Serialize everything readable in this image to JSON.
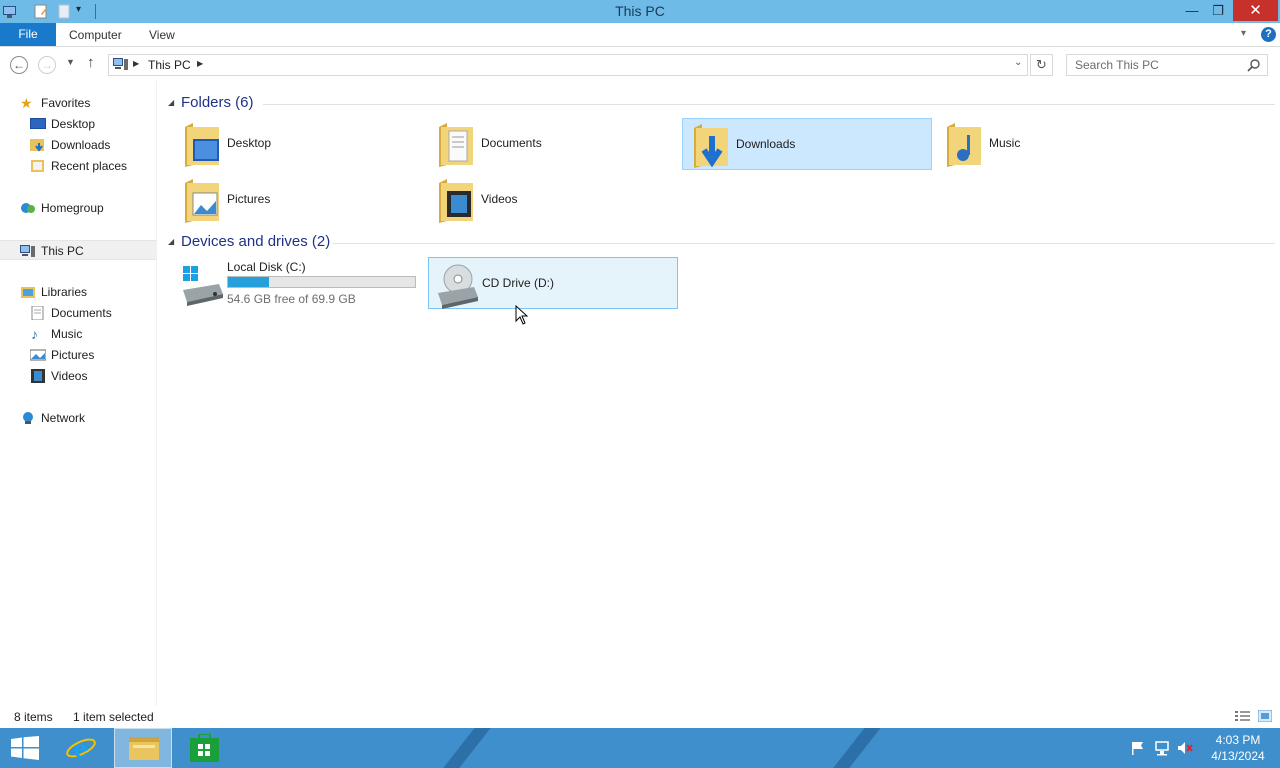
{
  "window": {
    "title": "This PC"
  },
  "quick_access": {
    "dropdown": "▾"
  },
  "window_controls": {
    "minimize": "—",
    "restore": "❐",
    "close": "✕"
  },
  "ribbon": {
    "file": "File",
    "tabs": [
      "Computer",
      "View"
    ],
    "help": "?"
  },
  "address": {
    "location": "This PC",
    "search_placeholder": "Search This PC"
  },
  "nav_pane": {
    "favorites": "Favorites",
    "favorites_items": [
      "Desktop",
      "Downloads",
      "Recent places"
    ],
    "homegroup": "Homegroup",
    "this_pc": "This PC",
    "libraries": "Libraries",
    "libraries_items": [
      "Documents",
      "Music",
      "Pictures",
      "Videos"
    ],
    "network": "Network"
  },
  "groups": {
    "folders": {
      "heading": "Folders (6)",
      "items": [
        "Desktop",
        "Documents",
        "Downloads",
        "Music",
        "Pictures",
        "Videos"
      ],
      "selected": "Downloads"
    },
    "devices": {
      "heading": "Devices and drives (2)",
      "local_disk": {
        "name": "Local Disk (C:)",
        "free_text": "54.6 GB free of 69.9 GB",
        "used_fraction": 0.219
      },
      "cd_drive": {
        "name": "CD Drive (D:)"
      }
    }
  },
  "status": {
    "item_count": "8 items",
    "selection": "1 item selected"
  },
  "taskbar": {
    "time": "4:03 PM",
    "date": "4/13/2024"
  },
  "colors": {
    "accent": "#1979ca",
    "titlebar": "#6ebbe8",
    "taskbar": "#3e8fcc",
    "selection": "#cce8ff",
    "group_heading": "#1e3287"
  }
}
